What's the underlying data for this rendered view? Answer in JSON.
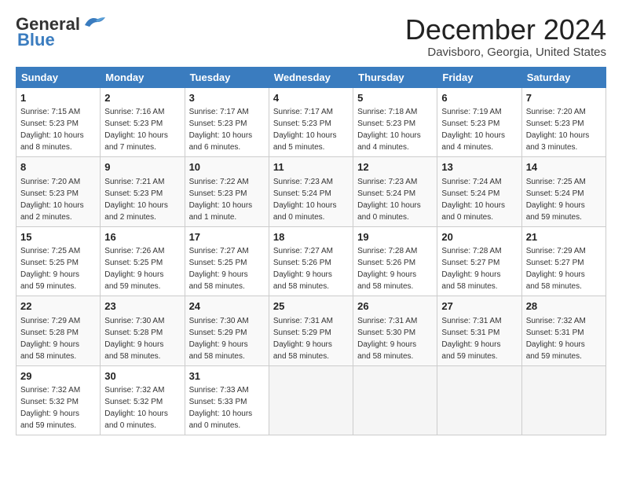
{
  "logo": {
    "line1": "General",
    "line2": "Blue"
  },
  "title": "December 2024",
  "subtitle": "Davisboro, Georgia, United States",
  "headers": [
    "Sunday",
    "Monday",
    "Tuesday",
    "Wednesday",
    "Thursday",
    "Friday",
    "Saturday"
  ],
  "weeks": [
    [
      {
        "day": "1",
        "info": "Sunrise: 7:15 AM\nSunset: 5:23 PM\nDaylight: 10 hours\nand 8 minutes."
      },
      {
        "day": "2",
        "info": "Sunrise: 7:16 AM\nSunset: 5:23 PM\nDaylight: 10 hours\nand 7 minutes."
      },
      {
        "day": "3",
        "info": "Sunrise: 7:17 AM\nSunset: 5:23 PM\nDaylight: 10 hours\nand 6 minutes."
      },
      {
        "day": "4",
        "info": "Sunrise: 7:17 AM\nSunset: 5:23 PM\nDaylight: 10 hours\nand 5 minutes."
      },
      {
        "day": "5",
        "info": "Sunrise: 7:18 AM\nSunset: 5:23 PM\nDaylight: 10 hours\nand 4 minutes."
      },
      {
        "day": "6",
        "info": "Sunrise: 7:19 AM\nSunset: 5:23 PM\nDaylight: 10 hours\nand 4 minutes."
      },
      {
        "day": "7",
        "info": "Sunrise: 7:20 AM\nSunset: 5:23 PM\nDaylight: 10 hours\nand 3 minutes."
      }
    ],
    [
      {
        "day": "8",
        "info": "Sunrise: 7:20 AM\nSunset: 5:23 PM\nDaylight: 10 hours\nand 2 minutes."
      },
      {
        "day": "9",
        "info": "Sunrise: 7:21 AM\nSunset: 5:23 PM\nDaylight: 10 hours\nand 2 minutes."
      },
      {
        "day": "10",
        "info": "Sunrise: 7:22 AM\nSunset: 5:23 PM\nDaylight: 10 hours\nand 1 minute."
      },
      {
        "day": "11",
        "info": "Sunrise: 7:23 AM\nSunset: 5:24 PM\nDaylight: 10 hours\nand 0 minutes."
      },
      {
        "day": "12",
        "info": "Sunrise: 7:23 AM\nSunset: 5:24 PM\nDaylight: 10 hours\nand 0 minutes."
      },
      {
        "day": "13",
        "info": "Sunrise: 7:24 AM\nSunset: 5:24 PM\nDaylight: 10 hours\nand 0 minutes."
      },
      {
        "day": "14",
        "info": "Sunrise: 7:25 AM\nSunset: 5:24 PM\nDaylight: 9 hours\nand 59 minutes."
      }
    ],
    [
      {
        "day": "15",
        "info": "Sunrise: 7:25 AM\nSunset: 5:25 PM\nDaylight: 9 hours\nand 59 minutes."
      },
      {
        "day": "16",
        "info": "Sunrise: 7:26 AM\nSunset: 5:25 PM\nDaylight: 9 hours\nand 59 minutes."
      },
      {
        "day": "17",
        "info": "Sunrise: 7:27 AM\nSunset: 5:25 PM\nDaylight: 9 hours\nand 58 minutes."
      },
      {
        "day": "18",
        "info": "Sunrise: 7:27 AM\nSunset: 5:26 PM\nDaylight: 9 hours\nand 58 minutes."
      },
      {
        "day": "19",
        "info": "Sunrise: 7:28 AM\nSunset: 5:26 PM\nDaylight: 9 hours\nand 58 minutes."
      },
      {
        "day": "20",
        "info": "Sunrise: 7:28 AM\nSunset: 5:27 PM\nDaylight: 9 hours\nand 58 minutes."
      },
      {
        "day": "21",
        "info": "Sunrise: 7:29 AM\nSunset: 5:27 PM\nDaylight: 9 hours\nand 58 minutes."
      }
    ],
    [
      {
        "day": "22",
        "info": "Sunrise: 7:29 AM\nSunset: 5:28 PM\nDaylight: 9 hours\nand 58 minutes."
      },
      {
        "day": "23",
        "info": "Sunrise: 7:30 AM\nSunset: 5:28 PM\nDaylight: 9 hours\nand 58 minutes."
      },
      {
        "day": "24",
        "info": "Sunrise: 7:30 AM\nSunset: 5:29 PM\nDaylight: 9 hours\nand 58 minutes."
      },
      {
        "day": "25",
        "info": "Sunrise: 7:31 AM\nSunset: 5:29 PM\nDaylight: 9 hours\nand 58 minutes."
      },
      {
        "day": "26",
        "info": "Sunrise: 7:31 AM\nSunset: 5:30 PM\nDaylight: 9 hours\nand 58 minutes."
      },
      {
        "day": "27",
        "info": "Sunrise: 7:31 AM\nSunset: 5:31 PM\nDaylight: 9 hours\nand 59 minutes."
      },
      {
        "day": "28",
        "info": "Sunrise: 7:32 AM\nSunset: 5:31 PM\nDaylight: 9 hours\nand 59 minutes."
      }
    ],
    [
      {
        "day": "29",
        "info": "Sunrise: 7:32 AM\nSunset: 5:32 PM\nDaylight: 9 hours\nand 59 minutes."
      },
      {
        "day": "30",
        "info": "Sunrise: 7:32 AM\nSunset: 5:32 PM\nDaylight: 10 hours\nand 0 minutes."
      },
      {
        "day": "31",
        "info": "Sunrise: 7:33 AM\nSunset: 5:33 PM\nDaylight: 10 hours\nand 0 minutes."
      },
      null,
      null,
      null,
      null
    ]
  ]
}
